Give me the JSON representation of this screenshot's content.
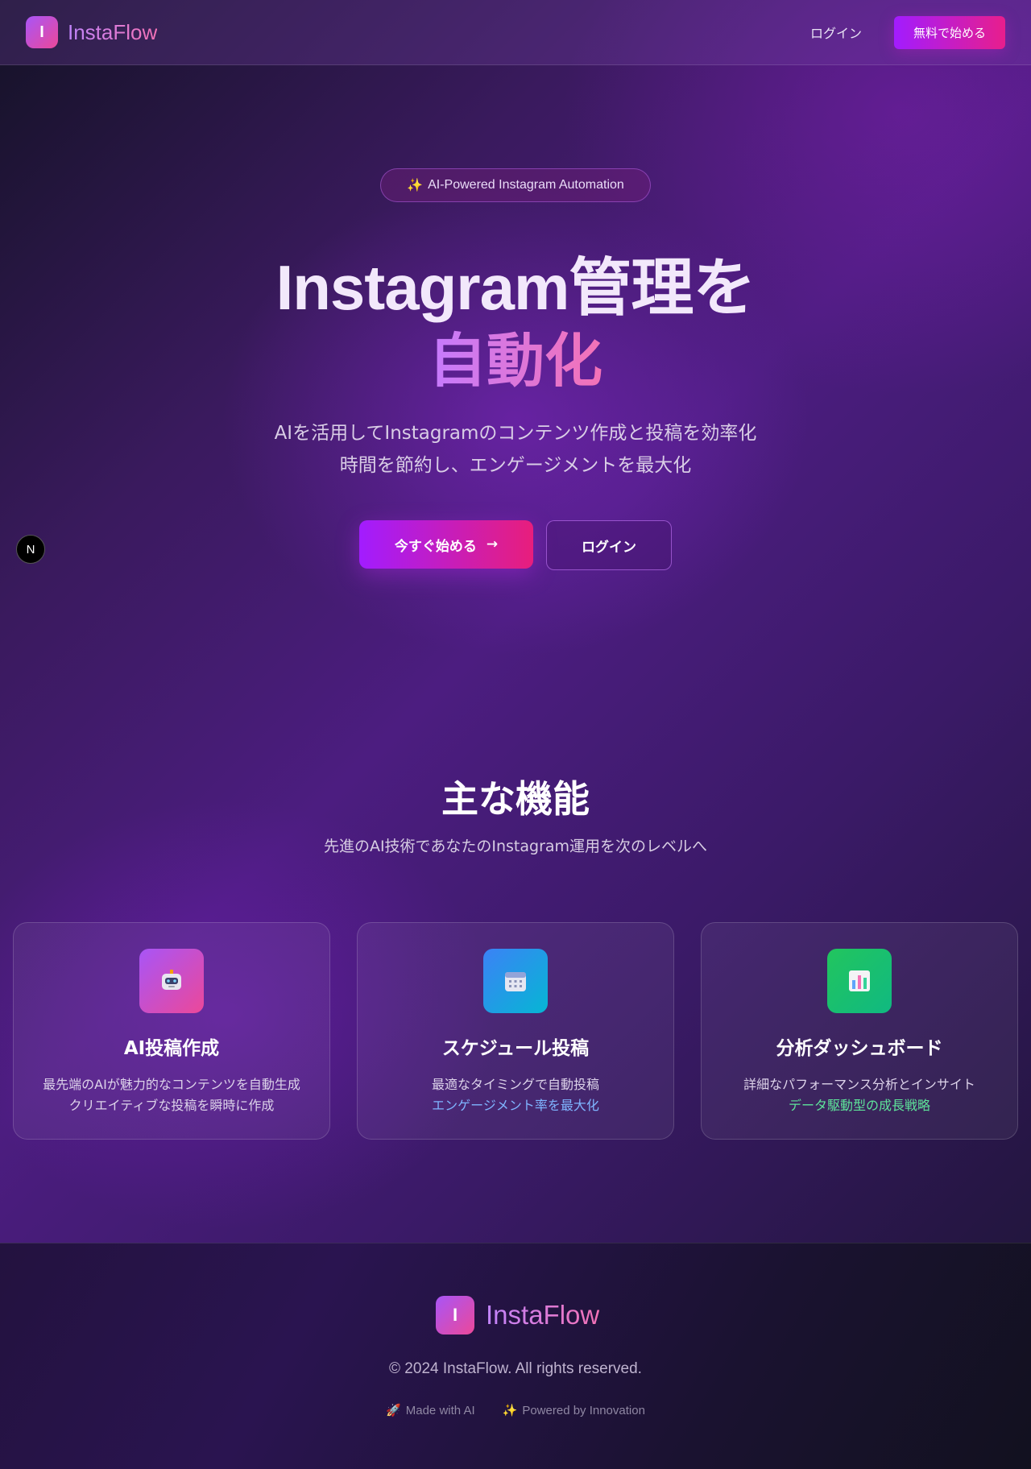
{
  "header": {
    "logo_letter": "I",
    "brand": "InstaFlow",
    "login": "ログイン",
    "cta": "無料で始める"
  },
  "hero": {
    "badge_icon": "✨",
    "badge_text": "AI-Powered Instagram Automation",
    "title_line1": "Instagram管理を",
    "title_line2": "自動化",
    "subtitle_line1": "AIを活用してInstagramのコンテンツ作成と投稿を効率化",
    "subtitle_line2": "時間を節約し、エンゲージメントを最大化",
    "primary_button": "今すぐ始める",
    "primary_arrow": "→",
    "secondary_button": "ログイン"
  },
  "floating_badge": "N",
  "features": {
    "title": "主な機能",
    "subtitle": "先進のAI技術であなたのInstagram運用を次のレベルへ",
    "cards": [
      {
        "icon": "robot-icon",
        "title": "AI投稿作成",
        "desc1": "最先端のAIが魅力的なコンテンツを自動生成",
        "desc2": "クリエイティブな投稿を瞬時に作成",
        "desc2_color": "#ddd3ea",
        "icon_gradient": [
          "#a855f7",
          "#ec4899"
        ]
      },
      {
        "icon": "calendar-icon",
        "title": "スケジュール投稿",
        "desc1": "最適なタイミングで自動投稿",
        "desc2": "エンゲージメント率を最大化",
        "desc2_color": "#7fb4ff",
        "icon_gradient": [
          "#3b82f6",
          "#06b6d4"
        ]
      },
      {
        "icon": "bar-chart-icon",
        "title": "分析ダッシュボード",
        "desc1": "詳細なパフォーマンス分析とインサイト",
        "desc2": "データ駆動型の成長戦略",
        "desc2_color": "#5ee49a",
        "icon_gradient": [
          "#22c55e",
          "#10b981"
        ]
      }
    ]
  },
  "footer": {
    "logo_letter": "I",
    "brand": "InstaFlow",
    "copyright": "© 2024 InstaFlow. All rights reserved.",
    "tag1_icon": "🚀",
    "tag1": "Made with AI",
    "tag2_icon": "✨",
    "tag2": "Powered by Innovation"
  }
}
